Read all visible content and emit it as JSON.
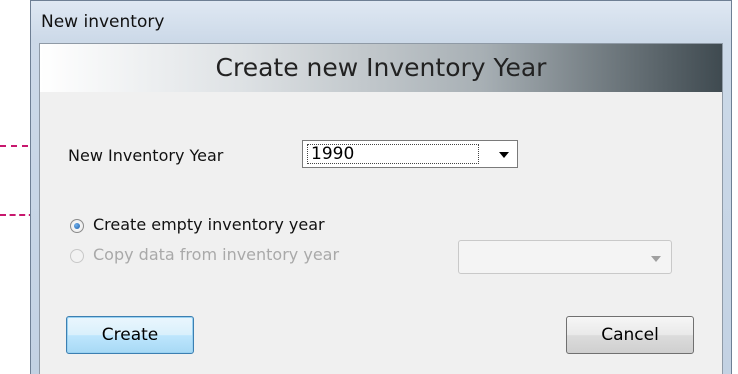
{
  "window": {
    "title": "New inventory"
  },
  "header": {
    "title": "Create new Inventory Year"
  },
  "form": {
    "year_label": "New Inventory Year",
    "year_value": "1990",
    "radio_empty_label": "Create empty inventory year",
    "radio_copy_label": "Copy data from inventory year",
    "copy_source_value": ""
  },
  "buttons": {
    "create": "Create",
    "cancel": "Cancel"
  },
  "colors": {
    "annotation_arrow": "#c8176e",
    "default_button_border": "#3c7fb1"
  }
}
